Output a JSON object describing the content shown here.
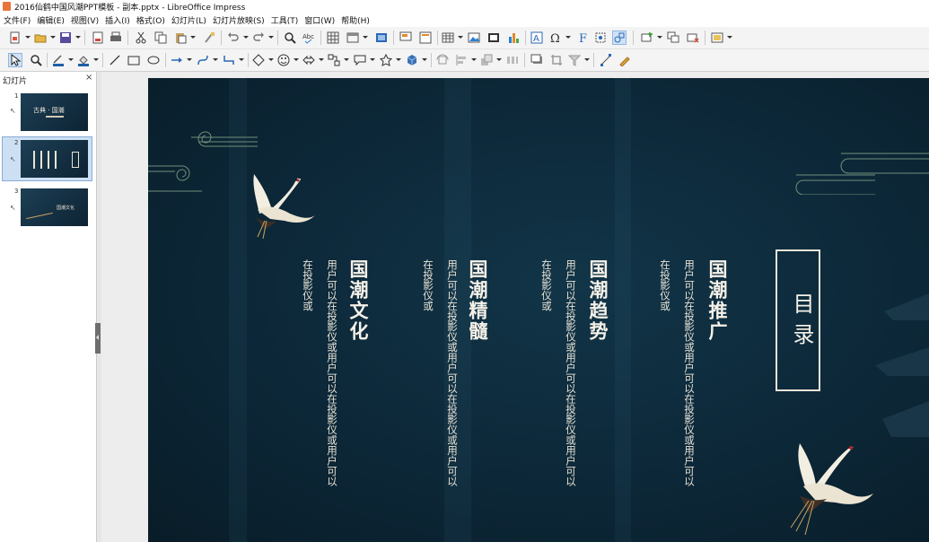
{
  "window": {
    "title": "2016仙鹤中国风潮PPT模板 - 副本.pptx - LibreOffice Impress"
  },
  "menu": [
    "文件(F)",
    "编辑(E)",
    "视图(V)",
    "插入(I)",
    "格式(O)",
    "幻灯片(L)",
    "幻灯片放映(S)",
    "工具(T)",
    "窗口(W)",
    "帮助(H)"
  ],
  "slides_panel": {
    "title": "幻灯片",
    "close": "×",
    "thumbs": [
      {
        "num": "1",
        "text": "古典 · 国潮"
      },
      {
        "num": "2",
        "text": ""
      },
      {
        "num": "3",
        "text": "国潮文化"
      }
    ]
  },
  "slide": {
    "heading": "目录",
    "sections": [
      {
        "title": "国潮推广",
        "body": "用户可以在投影仪或用户可以在投影仪或用户可以在投影仪或"
      },
      {
        "title": "国潮趋势",
        "body": "用户可以在投影仪或用户可以在投影仪或用户可以在投影仪或"
      },
      {
        "title": "国潮精髓",
        "body": "用户可以在投影仪或用户可以在投影仪或用户可以在投影仪或"
      },
      {
        "title": "国潮文化",
        "body": "用户可以在投影仪或用户可以在投影仪或用户可以在投影仪或"
      }
    ]
  },
  "icons": {
    "toolbar1": [
      "new-document-icon",
      "open-folder-icon",
      "save-icon",
      "export-pdf-icon",
      "print-icon",
      "cut-icon",
      "copy-icon",
      "paste-icon",
      "clone-formatting-icon",
      "undo-icon",
      "redo-icon",
      "find-replace-icon",
      "spellcheck-icon",
      "grid-icon",
      "display-views-icon",
      "master-slide-icon",
      "start-slideshow-icon",
      "slide-layout-icon",
      "table-icon",
      "image-icon",
      "media-icon",
      "chart-icon",
      "textbox-icon",
      "special-character-icon",
      "fontwork-icon",
      "transformations-icon",
      "new-slide-icon",
      "duplicate-slide-icon",
      "delete-slide-icon",
      "slide-background-icon"
    ],
    "toolbar2": [
      "select-icon",
      "zoom-icon",
      "line-color-icon",
      "fill-color-icon",
      "line-icon",
      "rectangle-icon",
      "ellipse-icon",
      "arrow-line-icon",
      "curve-icon",
      "connector-icon",
      "basic-shapes-icon",
      "symbol-shapes-icon",
      "block-arrows-icon",
      "flowchart-icon",
      "callouts-icon",
      "stars-icon",
      "3d-objects-icon",
      "rotate-icon",
      "align-icon",
      "arrange-icon",
      "distribute-icon",
      "shadow-icon",
      "crop-icon",
      "filter-icon",
      "points-icon",
      "glue-points-icon"
    ]
  },
  "colors": {
    "slide_bg": "#0d2a3b",
    "slide_text": "#f5f1e8",
    "accent_blue": "#1d5fa8",
    "selection": "#cde0f3"
  }
}
